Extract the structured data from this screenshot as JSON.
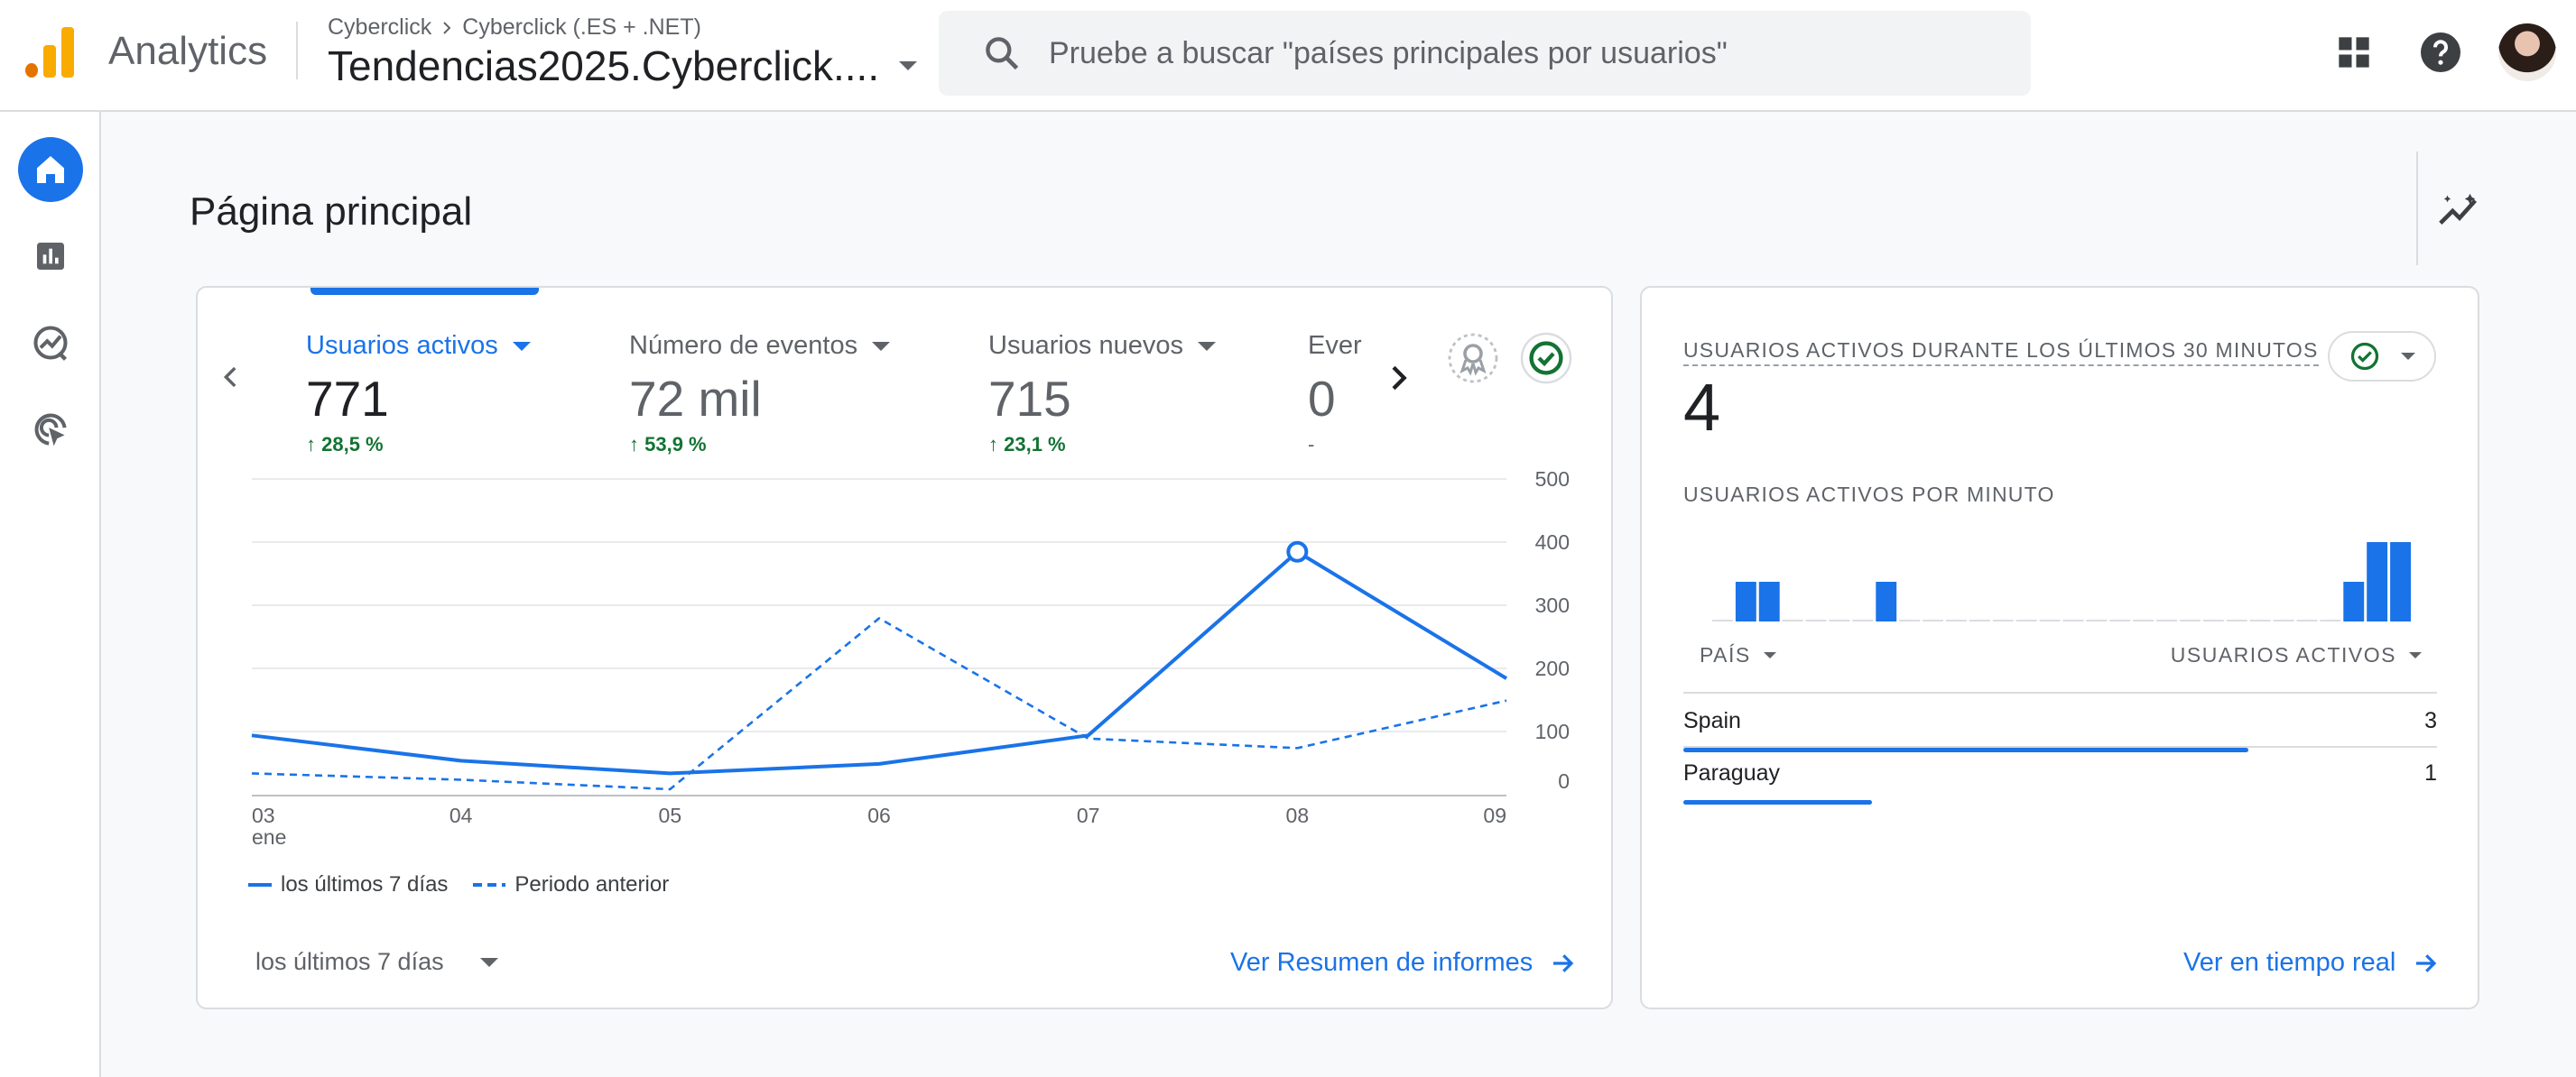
{
  "header": {
    "app_name": "Analytics",
    "breadcrumb": {
      "account": "Cyberclick",
      "separator_icon": "chevron-right-icon",
      "property": "Cyberclick (.ES + .NET)"
    },
    "property_name": "Tendencias2025.Cyberclick....",
    "search_placeholder": "Pruebe a buscar \"países principales por usuarios\"",
    "icons": [
      "search-icon",
      "apps-grid-icon",
      "help-icon",
      "avatar"
    ]
  },
  "sidenav": {
    "items": [
      {
        "name": "home-icon",
        "active": true
      },
      {
        "name": "reports-icon",
        "active": false
      },
      {
        "name": "explore-icon",
        "active": false
      },
      {
        "name": "advertising-icon",
        "active": false
      }
    ]
  },
  "page": {
    "title": "Página principal"
  },
  "overview": {
    "metrics": [
      {
        "label": "Usuarios activos",
        "value": "771",
        "change": "28,5 %",
        "selected": true
      },
      {
        "label": "Número de eventos",
        "value": "72 mil",
        "change": "53,9 %",
        "selected": false
      },
      {
        "label": "Usuarios nuevos",
        "value": "715",
        "change": "23,1 %",
        "selected": false
      },
      {
        "label": "Ever",
        "value": "0",
        "change": "-",
        "selected": false
      }
    ],
    "period_label": "los últimos 7 días",
    "link_label": "Ver Resumen de informes"
  },
  "chart_data": {
    "type": "line",
    "x": [
      "03",
      "04",
      "05",
      "06",
      "07",
      "08",
      "09"
    ],
    "x_sublabel_first": "ene",
    "yticks": [
      500,
      400,
      300,
      200,
      100,
      0
    ],
    "ylim": [
      0,
      500
    ],
    "series": [
      {
        "name": "los últimos 7 días",
        "values": [
          95,
          55,
          35,
          50,
          95,
          385,
          185
        ],
        "style": "solid"
      },
      {
        "name": "Periodo anterior",
        "values": [
          35,
          25,
          10,
          280,
          90,
          75,
          150
        ],
        "style": "dashed"
      }
    ],
    "highlight": {
      "series": 0,
      "index": 5
    },
    "grid": true,
    "legend": "bottom-left",
    "color": "#1a73e8"
  },
  "realtime": {
    "title": "USUARIOS ACTIVOS DURANTE LOS ÚLTIMOS 30 MINUTOS",
    "value": "4",
    "subtitle": "USUARIOS ACTIVOS POR MINUTO",
    "per_minute": [
      0,
      1,
      1,
      0,
      0,
      0,
      0,
      1,
      0,
      0,
      0,
      0,
      0,
      0,
      0,
      0,
      0,
      0,
      0,
      0,
      0,
      0,
      0,
      0,
      0,
      0,
      0,
      1,
      2,
      2
    ],
    "table": {
      "col_country": "PAÍS",
      "col_users": "USUARIOS ACTIVOS",
      "rows": [
        {
          "country": "Spain",
          "users": "3",
          "share": 0.75
        },
        {
          "country": "Paraguay",
          "users": "1",
          "share": 0.25
        }
      ]
    },
    "link_label": "Ver en tiempo real"
  }
}
